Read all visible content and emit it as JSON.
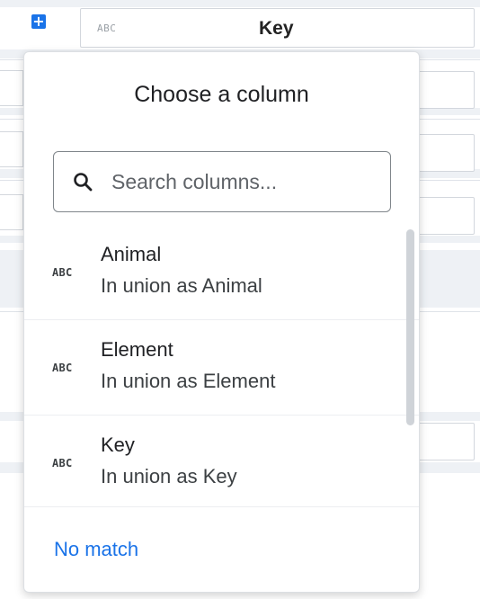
{
  "colors": {
    "accent": "#1a73e8",
    "grid_strip": "#eef1f5",
    "border": "#d3d7dd"
  },
  "header": {
    "add_button_icon": "plus-icon",
    "add_button_glyph": "+",
    "type_tag": "ABC",
    "column_label": "Key"
  },
  "dropdown": {
    "title": "Choose a column",
    "search": {
      "icon": "search-icon",
      "placeholder": "Search columns...",
      "value": ""
    },
    "columns": [
      {
        "type": "ABC",
        "name": "Animal",
        "subtitle": "In union as Animal"
      },
      {
        "type": "ABC",
        "name": "Element",
        "subtitle": "In union as Element"
      },
      {
        "type": "ABC",
        "name": "Key",
        "subtitle": "In union as Key"
      }
    ],
    "footer_link": "No match"
  }
}
